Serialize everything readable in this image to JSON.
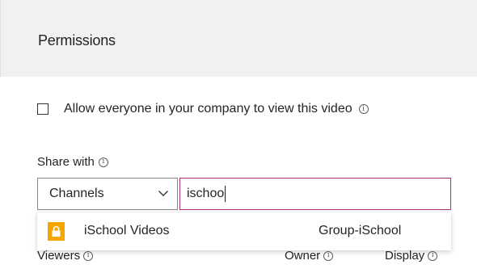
{
  "header": {
    "title": "Permissions"
  },
  "allow_everyone": {
    "label": "Allow everyone in your company to view this video",
    "checked": false,
    "info_glyph": "i"
  },
  "share": {
    "label": "Share with",
    "info_glyph": "i",
    "type_dropdown": {
      "selected": "Channels"
    },
    "search": {
      "value": "ischoo"
    }
  },
  "suggestions": [
    {
      "icon": "lock-icon",
      "icon_color": "#f7a600",
      "name": "iSchool Videos",
      "type": "Group-iSchool"
    }
  ],
  "table_headers": {
    "viewers": "Viewers",
    "owner": "Owner",
    "display": "Display",
    "info_glyph": "i"
  },
  "colors": {
    "header_bg": "#f2f1f0",
    "focus_border": "#a4346e",
    "lock_tile": "#f7a600"
  }
}
